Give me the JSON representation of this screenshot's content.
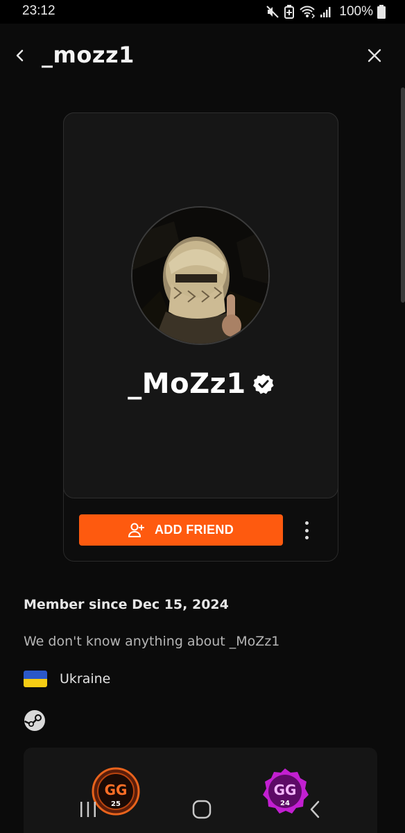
{
  "status_bar": {
    "time": "23:12",
    "battery": "100%",
    "icons": [
      "mute-icon",
      "battery-saver-icon",
      "wifi-icon",
      "signal-icon",
      "battery-icon"
    ]
  },
  "header": {
    "title": "_mozz1",
    "back_icon": "chevron-left-icon",
    "close_icon": "close-icon"
  },
  "profile": {
    "display_name": "_MoZz1",
    "verified": true,
    "avatar_alt": "avatar",
    "add_friend_label": "ADD FRIEND",
    "member_since": "Member since Dec 15, 2024",
    "about": "We don't know anything about _MoZz1",
    "country": "Ukraine",
    "platform_icon": "steam-icon"
  },
  "badges": [
    {
      "text": "GG",
      "year": "25",
      "color": "#e8631c"
    },
    {
      "text": "GG",
      "year": "24",
      "color": "#c21fd1"
    }
  ],
  "colors": {
    "accent": "#fe5a0f",
    "background": "#0b0b0b",
    "card": "#161616",
    "flag_blue": "#2b58c8",
    "flag_yellow": "#f5cc14"
  }
}
